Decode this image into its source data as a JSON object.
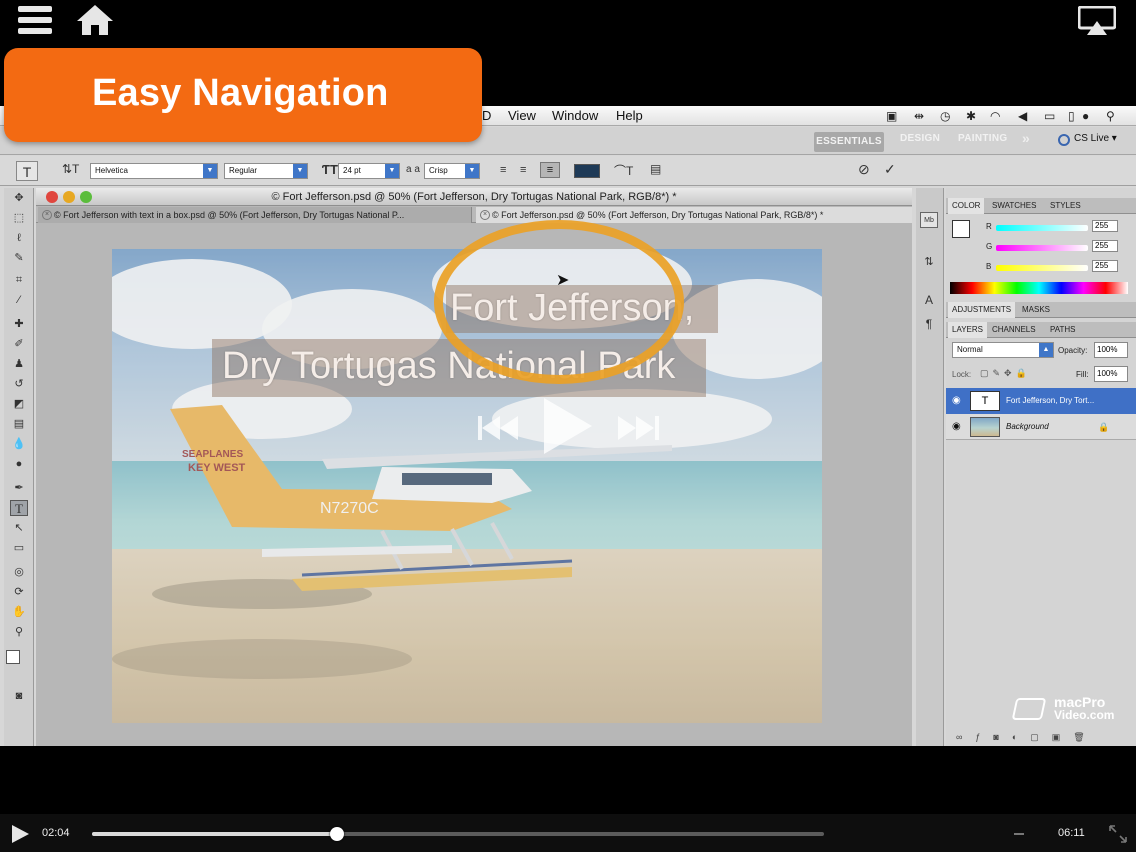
{
  "app_bar": {
    "menu_icon": "list-icon",
    "home_icon": "home-icon",
    "airplay_icon": "airplay-icon"
  },
  "callout": {
    "text": "Easy Navigation",
    "color": "#f36a12"
  },
  "mac_menu": {
    "items": [
      "D",
      "View",
      "Window",
      "Help"
    ]
  },
  "ps_appbar": {
    "workspaces": [
      "ESSENTIALS",
      "DESIGN",
      "PAINTING"
    ],
    "more": "»",
    "cs_live": "CS Live ▾"
  },
  "options_bar": {
    "tool_glyph": "T",
    "font_family": "Helvetica",
    "font_style": "Regular",
    "font_size": "24 pt",
    "aa_label": "a a",
    "antialias": "Crisp",
    "text_color": "#1e3a57"
  },
  "document": {
    "title": "© Fort Jefferson.psd @ 50% (Fort Jefferson,  Dry Tortugas National Park, RGB/8*) *",
    "tabs": [
      {
        "label": "© Fort Jefferson with text in a box.psd @ 50% (Fort Jefferson,  Dry Tortugas National P..."
      },
      {
        "label": "© Fort Jefferson.psd @ 50% (Fort Jefferson,  Dry Tortugas National Park, RGB/8*) *"
      }
    ],
    "text_line1": "Fort Jefferson,",
    "text_line2": "Dry Tortugas National Park",
    "plane_text1": "SEAPLANES",
    "plane_text2": "KEY WEST",
    "plane_tail": "N7270C"
  },
  "panels": {
    "color_tabs": [
      "COLOR",
      "SWATCHES",
      "STYLES"
    ],
    "rgb": [
      {
        "label": "R",
        "value": "255"
      },
      {
        "label": "G",
        "value": "255"
      },
      {
        "label": "B",
        "value": "255"
      }
    ],
    "adj_tabs": [
      "ADJUSTMENTS",
      "MASKS"
    ],
    "layer_tabs": [
      "LAYERS",
      "CHANNELS",
      "PATHS"
    ],
    "blend_mode": "Normal",
    "opacity_label": "Opacity:",
    "opacity": "100%",
    "lock_label": "Lock:",
    "fill_label": "Fill:",
    "fill": "100%",
    "layers": [
      {
        "name": "Fort Jefferson,  Dry Tort...",
        "thumb": "T"
      },
      {
        "name": "Background"
      }
    ]
  },
  "branding": {
    "line1": "macPro",
    "line2": "Video.com"
  },
  "player": {
    "current_time": "02:04",
    "total_time": "06:11",
    "progress": 0.3342
  }
}
